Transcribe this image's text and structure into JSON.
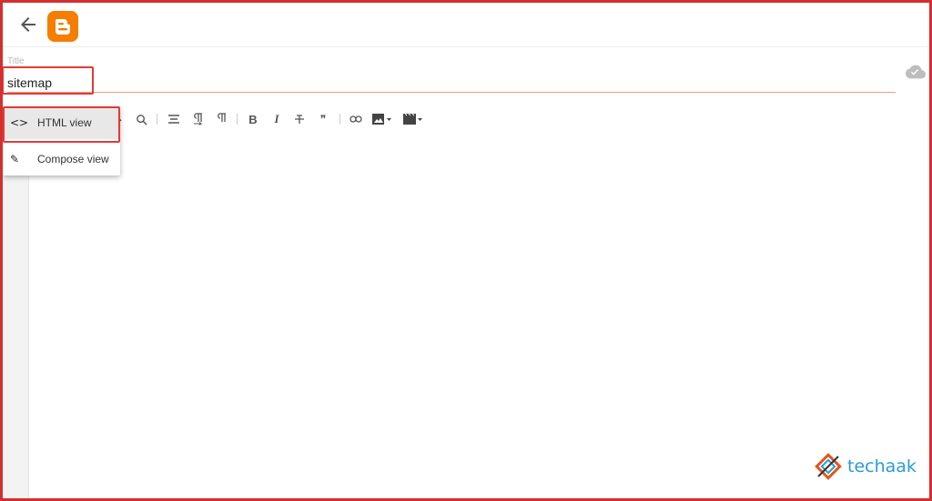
{
  "header": {
    "back_icon": "arrow-left-icon",
    "logo_icon": "blogger-logo-icon",
    "brand_color": "#f57d00"
  },
  "title": {
    "label": "Title",
    "value": "sitemap"
  },
  "status": {
    "cloud_icon": "cloud-saved-icon"
  },
  "toolbar": {
    "items": [
      "undo-icon",
      "find-replace-icon",
      "align-icon",
      "paragraph-ltr-icon",
      "paragraph-rtl-icon",
      "bold-icon",
      "italic-icon",
      "strikethrough-icon",
      "quote-icon",
      "link-icon",
      "image-icon",
      "video-icon"
    ],
    "bold_glyph": "B",
    "italic_glyph": "I",
    "quote_glyph": "❞"
  },
  "view_menu": {
    "items": [
      {
        "label": "HTML view",
        "icon": "code-icon",
        "glyph": "<>"
      },
      {
        "label": "Compose view",
        "icon": "pencil-icon",
        "glyph": "✎"
      }
    ]
  },
  "brand": {
    "name": "techaak"
  },
  "highlight_color": "#e53935"
}
